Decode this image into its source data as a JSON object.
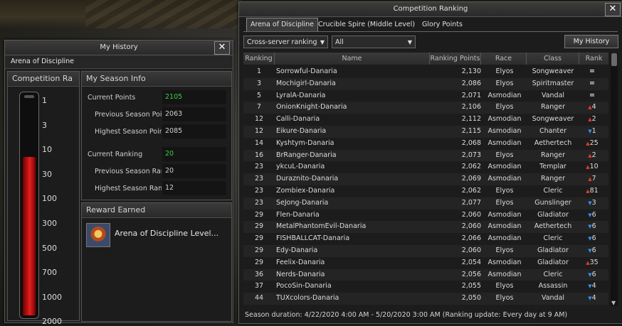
{
  "history": {
    "title": "My History",
    "subtitle": "Arena of Discipline",
    "competition_header": "Competition Ra",
    "gauge_ticks": [
      "1",
      "3",
      "10",
      "30",
      "100",
      "300",
      "500",
      "700",
      "1000",
      "2000"
    ],
    "gauge_fill_fraction": 0.72,
    "season_header": "My Season Info",
    "season": [
      {
        "label": "Current Points",
        "value": "2105",
        "highlight": true
      },
      {
        "label": "Previous Season Poir",
        "value": "2063",
        "highlight": false
      },
      {
        "label": "Highest Season Poin",
        "value": "2085",
        "highlight": false
      },
      {
        "label": "Current Ranking",
        "value": "20",
        "highlight": true
      },
      {
        "label": "Previous Season Ran",
        "value": "20",
        "highlight": false
      },
      {
        "label": "Highest Season Ran",
        "value": "12",
        "highlight": false
      }
    ],
    "reward_header": "Reward Earned",
    "reward_text": "Arena of Discipline Level..."
  },
  "ranking": {
    "title": "Competition Ranking",
    "tabs": [
      "Arena of Discipline",
      "Crucible Spire (Middle Level)",
      "Glory Points"
    ],
    "active_tab": 0,
    "scope_select": "Cross-server ranking",
    "filter_select": "All",
    "my_history_button": "My History",
    "columns": [
      "Ranking",
      "Name",
      "Ranking Points",
      "Race",
      "Class",
      "Rank"
    ],
    "rows": [
      {
        "rank": "1",
        "name": "Sorrowful-Danaria",
        "points": "2,130",
        "race": "Elyos",
        "class": "Songweaver",
        "dir": "eq",
        "change": ""
      },
      {
        "rank": "3",
        "name": "Mochigirl-Danaria",
        "points": "2,086",
        "race": "Elyos",
        "class": "Spiritmaster",
        "dir": "eq",
        "change": ""
      },
      {
        "rank": "5",
        "name": "LyralA-Danaria",
        "points": "2,071",
        "race": "Asmodian",
        "class": "Vandal",
        "dir": "eq",
        "change": ""
      },
      {
        "rank": "7",
        "name": "OnionKnight-Danaria",
        "points": "2,106",
        "race": "Elyos",
        "class": "Ranger",
        "dir": "up",
        "change": "4"
      },
      {
        "rank": "12",
        "name": "Calli-Danaria",
        "points": "2,112",
        "race": "Asmodian",
        "class": "Songweaver",
        "dir": "up",
        "change": "2"
      },
      {
        "rank": "12",
        "name": "Eikure-Danaria",
        "points": "2,115",
        "race": "Asmodian",
        "class": "Chanter",
        "dir": "down",
        "change": "1"
      },
      {
        "rank": "14",
        "name": "Kyshtym-Danaria",
        "points": "2,068",
        "race": "Asmodian",
        "class": "Aethertech",
        "dir": "up",
        "change": "25"
      },
      {
        "rank": "16",
        "name": "BrRanger-Danaria",
        "points": "2,073",
        "race": "Elyos",
        "class": "Ranger",
        "dir": "up",
        "change": "2"
      },
      {
        "rank": "23",
        "name": "ykcuL-Danaria",
        "points": "2,062",
        "race": "Asmodian",
        "class": "Templar",
        "dir": "up",
        "change": "10"
      },
      {
        "rank": "23",
        "name": "Duraznito-Danaria",
        "points": "2,069",
        "race": "Asmodian",
        "class": "Ranger",
        "dir": "up",
        "change": "7"
      },
      {
        "rank": "23",
        "name": "Zombiex-Danaria",
        "points": "2,062",
        "race": "Elyos",
        "class": "Cleric",
        "dir": "up",
        "change": "81"
      },
      {
        "rank": "23",
        "name": "SeJong-Danaria",
        "points": "2,077",
        "race": "Elyos",
        "class": "Gunslinger",
        "dir": "down",
        "change": "3"
      },
      {
        "rank": "29",
        "name": "Flen-Danaria",
        "points": "2,060",
        "race": "Asmodian",
        "class": "Gladiator",
        "dir": "down",
        "change": "6"
      },
      {
        "rank": "29",
        "name": "MetalPhantomEvil-Danaria",
        "points": "2,060",
        "race": "Asmodian",
        "class": "Aethertech",
        "dir": "down",
        "change": "6"
      },
      {
        "rank": "29",
        "name": "FISHBALLCAT-Danaria",
        "points": "2,066",
        "race": "Asmodian",
        "class": "Cleric",
        "dir": "down",
        "change": "6"
      },
      {
        "rank": "29",
        "name": "Edy-Danaria",
        "points": "2,060",
        "race": "Elyos",
        "class": "Gladiator",
        "dir": "down",
        "change": "6"
      },
      {
        "rank": "29",
        "name": "Feelix-Danaria",
        "points": "2,054",
        "race": "Asmodian",
        "class": "Gladiator",
        "dir": "up",
        "change": "35"
      },
      {
        "rank": "36",
        "name": "Nerds-Danaria",
        "points": "2,056",
        "race": "Asmodian",
        "class": "Cleric",
        "dir": "down",
        "change": "6"
      },
      {
        "rank": "37",
        "name": "PocoSin-Danaria",
        "points": "2,055",
        "race": "Elyos",
        "class": "Assassin",
        "dir": "down",
        "change": "4"
      },
      {
        "rank": "44",
        "name": "TUXcolors-Danaria",
        "points": "2,050",
        "race": "Elyos",
        "class": "Vandal",
        "dir": "down",
        "change": "4"
      }
    ],
    "footer": "Season duration: 4/22/2020 4:00 AM - 5/20/2020 3:00 AM (Ranking update: Every day at 9 AM)"
  },
  "colors": {
    "up": "#e23a2a",
    "down": "#3a8ee8",
    "highlight": "#3ccf48"
  },
  "icons": {
    "close": "close-icon",
    "dropdown": "chevron-down-icon",
    "up": "arrow-up-icon",
    "down": "arrow-down-icon",
    "same": "equal-icon"
  }
}
